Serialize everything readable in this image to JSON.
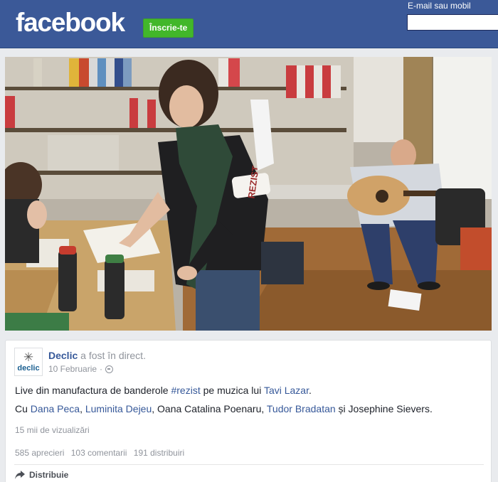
{
  "header": {
    "logo": "facebook",
    "signup_label": "Înscrie-te",
    "email_label": "E-mail sau mobil",
    "email_value": ""
  },
  "video": {
    "armband_text": "REZIST"
  },
  "post": {
    "author": "Declic",
    "author_status": "a fost în direct.",
    "date": "10 Februarie",
    "meta_separator": "·",
    "avatar_glyph": "✳",
    "avatar_text": "declic",
    "line1": {
      "before": "Live din manufactura de banderole ",
      "hashtag": "#rezist",
      "middle": " pe muzica lui ",
      "artist": "Tavi Lazar",
      "end": "."
    },
    "line2": {
      "prefix": "Cu ",
      "tag1": "Dana Peca",
      "sep1": ", ",
      "tag2": "Luminita Dejeu",
      "plain1": ", Oana Catalina Poenaru, ",
      "tag3": "Tudor Bradatan",
      "suffix": " și Josephine Sievers."
    },
    "views": "15 mii de vizualizări",
    "likes": "585 aprecieri",
    "comments": "103 comentarii",
    "shares": "191 distribuiri",
    "share_label": "Distribuie"
  },
  "colors": {
    "header_blue": "#3b5998",
    "signup_green": "#42b72a",
    "link_blue": "#365899"
  }
}
